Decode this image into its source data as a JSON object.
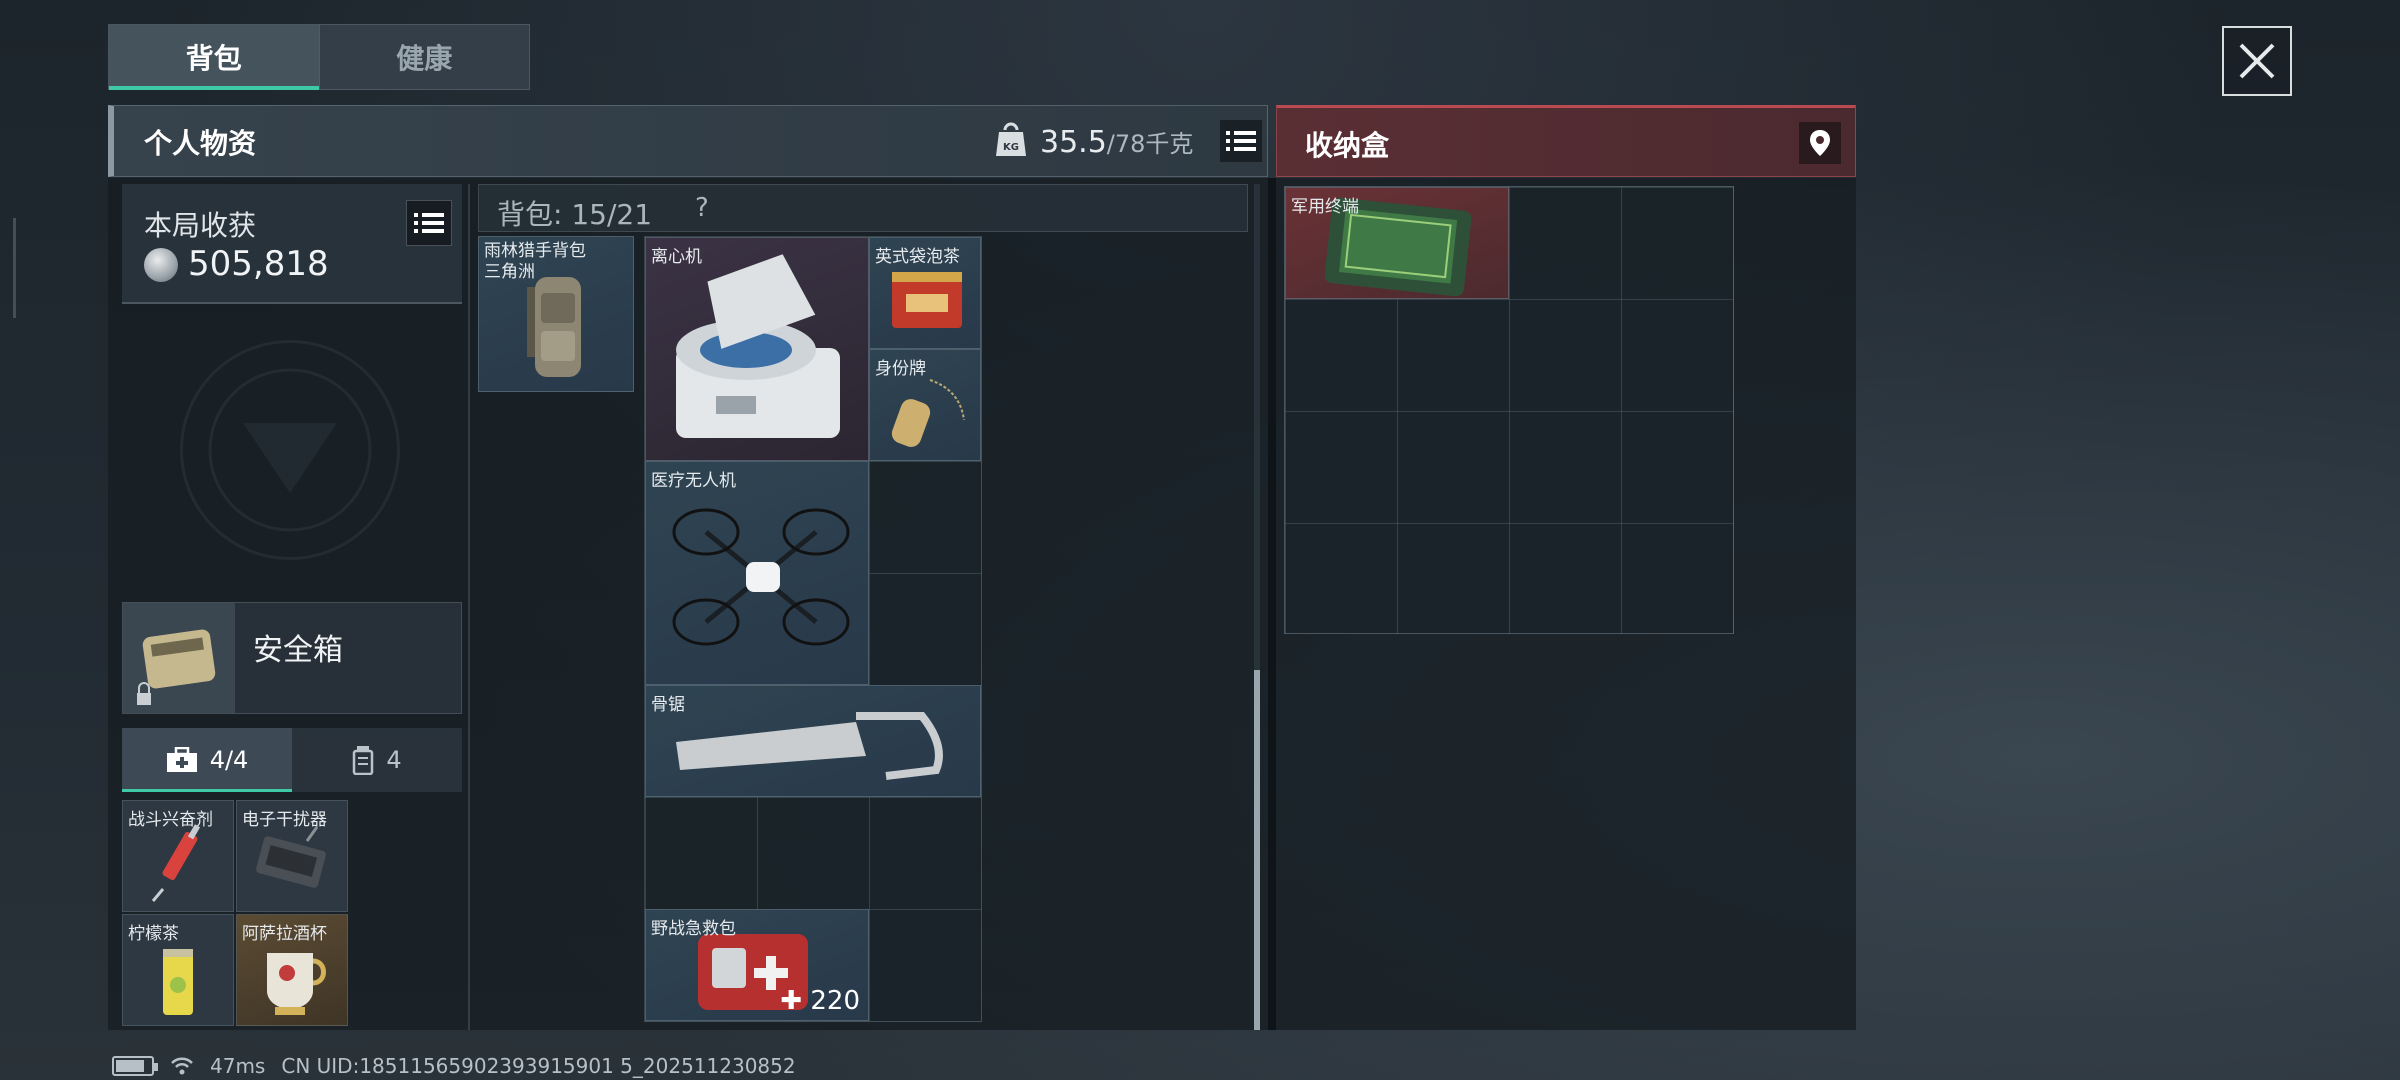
{
  "tabs": [
    {
      "label": "背包",
      "active": true
    },
    {
      "label": "健康",
      "active": false
    }
  ],
  "personal": {
    "title": "个人物资",
    "weight_current": "35.5",
    "weight_max": "/78千克",
    "weight_icon": "weight-kg-icon"
  },
  "storage": {
    "title": "收纳盒",
    "pin_icon": "location-pin-icon",
    "items": [
      {
        "label": "军用终端",
        "quality": "red"
      }
    ]
  },
  "harvest": {
    "label": "本局收获",
    "value": "505,818"
  },
  "safe": {
    "label": "安全箱"
  },
  "pouch_tabs": [
    {
      "label": "4/4",
      "icon": "medkit-icon",
      "active": true
    },
    {
      "label": "4",
      "icon": "canister-icon",
      "active": false
    }
  ],
  "pouch_items": [
    {
      "label": "战斗兴奋剂",
      "quality": "blue"
    },
    {
      "label": "电子干扰器",
      "quality": "blue"
    },
    {
      "label": "柠檬茶",
      "quality": "blue"
    },
    {
      "label": "阿萨拉酒杯",
      "quality": "gold"
    }
  ],
  "backpack": {
    "title": "背包: 15/21",
    "help": "?",
    "bag_item": "雨林猎手背包\n三角洲",
    "items": [
      {
        "label": "离心机",
        "quality": "purple"
      },
      {
        "label": "英式袋泡茶",
        "quality": "blue"
      },
      {
        "label": "身份牌",
        "quality": "blue"
      },
      {
        "label": "医疗无人机",
        "quality": "blue"
      },
      {
        "label": "骨锯",
        "quality": "blue"
      },
      {
        "label": "野战急救包",
        "quality": "blue",
        "count": "220"
      }
    ]
  },
  "footer": {
    "ping": "47ms",
    "uid": "CN UID:18511565902393915901 5_202511230852"
  },
  "colors": {
    "accent": "#3fc9a6",
    "storage_red": "#b84a52",
    "gold_quality": "#5b4b33",
    "purple_quality": "#3b3345",
    "blue_quality": "#2f4452"
  }
}
